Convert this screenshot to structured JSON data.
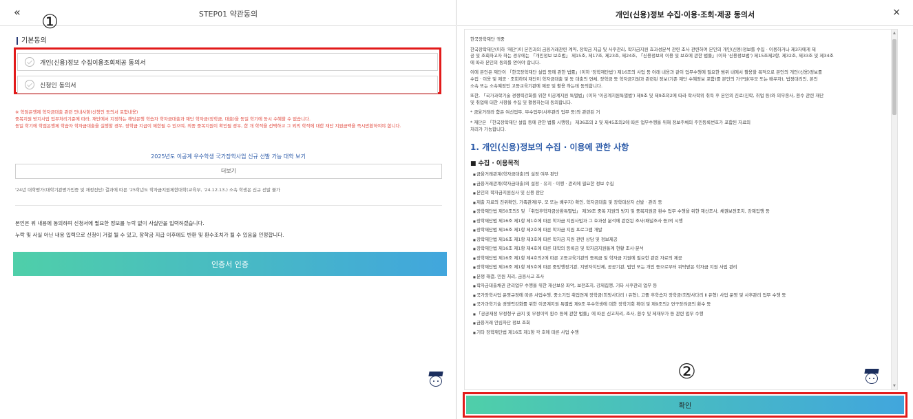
{
  "left": {
    "back_glyph": "«",
    "title": "STEP01 약관동의",
    "annotation": "①",
    "section_title": "기본동의",
    "consents": [
      {
        "label": "개인(신용)정보 수집이용조회제공 동의서"
      },
      {
        "label": "신청인 동의서"
      }
    ],
    "notice": [
      "※ 학점은행제 학자금대출 관련 안내사항(신청인 동의서 포함내용)",
      "중복지원 방지사업 업무처리기준에 따라, 재단에서 지정하는 해당은행 학습자 학자금대출과 재단 학자금(장학금, 대출)을 동일 학기에 동시 수혜할 수 없습니다.",
      "동일 학기에 학점은행제 학습자 학자금대출을 실행할 경우, 장학금 지급이 제한될 수 있으며, 최종 중복지원이 확인될 경우, 한 개 학적을 선택하고 그 외의 학적에 대한 재단 지원금액을 즉시반환하여야 합니다."
    ],
    "uni_link": "2025년도 이공계 우수학생 국가장학사업 신규 선발 가능 대학 보기",
    "more_button": "더보기",
    "small_note": "'24년 대학평가(대학기관평가인증 및 재정진단) 결과에 따른 '25학년도 학자금지원제한대학(교육부, '24.12.13.) 소속 학생은 신규 선발 불가",
    "confirm_line1": "본인은 위 내용에 동의하며 신청서에 필요한 정보를 누락 없이 사실만을 입력하겠습니다.",
    "confirm_line2": "누락 및 사실 아닌 내용 입력으로 신청이 거절 될 수 있고, 장학금 지급 이후에도 반환 및 환수조치가 될 수 있음을 인정합니다.",
    "cert_button": "인증서 인증"
  },
  "right": {
    "title": "개인(신용)정보 수집·이용·조회·제공 동의서",
    "close_glyph": "×",
    "paragraphs": [
      [
        "한국장학재단 귀중"
      ],
      [
        "한국장학재단(이하 '재단')이 본인과의 금융거래관련 계약, 장학금 지급 및 사후관리, 학자금지원 효과성분석 관련 조사 관련하여 본인의 개인(신용)정보를 수집 · 이용하거나 제3자에게 제",
        "공 및 조회하고자 하는 경우에는 「개인정보 보호법」 제15조, 제17조, 제23조, 제24조, 「신용정보의 이용 및 보호에 관한 법률」(이하 '신용정보법') 제15조제2항, 제32조, 제33조 및 제34조",
        "에 따라 본인의 동의를 얻어야 합니다."
      ],
      [
        "이에 본인은 재단이 「한국장학재단 설립 등에 관한 법률」(이하 '장학재단법') 제16조의 사업 등 아래 내용과 같이 업무수행에 필요한 범위 내에서 활용할 목적으로 본인의 개인(신용)정보를",
        "수집 · 이용 및 제공 · 조회하며 재단이 학자금대출 및 동 대출의 연체, 장학금 등 학자금지원과 관련된 정보(기존 재단 수혜정보 포함)를 본인의 가구원(부모 또는 배우자), 법정대리인, 본인",
        "소속 또는 소속예정인 고등교육기관에 제공 및 활용 하는데 동의합니다."
      ],
      [
        "또한, 「국가과학기술 경쟁력강화를 위한 이공계지원 특별법」(이하 '이공계지원특별법') 제9조 및 제9조의2에 따라 학사학위 취득 후 본인의 진로(진학, 취업 등)와 의무종사, 환수 관련 재단",
        "및 취업에 대한 사항을 수집 및 활용하는데 동의합니다."
      ],
      [
        "* 금융거래라 함은 여신업무, 부수업무(사후관리 업무 등)와 관련된 거"
      ],
      [
        "* 재단은 「한국장학재단 설립 등에 관한 법률 시행령」 제36조의 2 및                                                                    제45조의2에 따른 업무수행을 위해 정보주체의 주민등록번호가 포함된 자료의",
        "   처리가 가능합니다."
      ]
    ],
    "section_heading": "1. 개인(신용)정보의 수집 · 이용에 관한 사항",
    "subsection": "■ 수집 · 이용목적",
    "bullets": [
      "금융거래관계(학자금대출)의 설정 여부 판단",
      "금융거래관계(학자금대출)의 설정 · 유지 · 이행 · 관리에 필요한 정보 수집",
      "본인의 학자금지원심사 및 신용 판단",
      "제출 자료의 진위확인, 가족관계(부, 모 또는 배우자) 확인, 학자금대출 및 장학대상자 선발 · 관리 등",
      "장학재단법 제50조의5 및 「취업후학자금상환특별법」 제39조 중복 지원의 방지 및 중복지원금 환수 업무 수행을 위한 재산조사, 채권보전조치, 강제집행 등",
      "장학재단법 제16조 제1항 제1호에 따른 학자금 지원사업과 그 효과성 분석에 관련된 조사(패널조사 등)의 시행",
      "장학재단법 제16조 제1항 제2호에 따른 학자금 지원 프로그램 개발",
      "장학재단법 제16조 제1항 제3호에 따른 학자금 지원 관련 상담 및 정보제공",
      "장학재단법 제16조 제1항 제4호에 따른 대학의 등록금 및 학자금지원통계 현황 조사·분석",
      "장학재단법 제16조 제1항 제4호의2에 따른 고등교육기관의 등록금 및 학자금 지원에 필요한 관련 자료의 제공",
      "장학재단법 제16조 제1항 제5호에 따른 중앙행정기관, 지방자치단체, 공공기관, 법인 또는 개인 등으로부터 위탁받은 학자금 지원 사업 관리",
      "분쟁 해결, 민원 처리, 금융사고 조사",
      "학자금대출채권 관리업무 수행을 위한 재산보유 파악, 보전조치, 강제집행, 기타 사후관리 업무 등",
      "국가장학사업 운영규정에 따른 사업수행, 중소기업 취업연계 장학금(희망사다리 Ⅰ 유형), 고졸 후학습자 장학금(희망사다리 Ⅱ 유형) 사업 운영 및 사후관리 업무 수행 등",
      "국가과학기술 경쟁력강화를 위한 이공계지원 특별법 제9조 우수학생에 대한 장학기회 확대 및 제9조의2 연구장려금의 환수 등",
      "「공공재정 부정청구 금지 및 부정이익 환수 등에 관한 법률」에 따른 신고처리, 조사, 환수 및 제재부가 등 관련 업무 수행",
      "금융거래 안심차단 정보 조회",
      "기타 장학재단법 제16조 제1항 각 호에 따른 사업 수행"
    ],
    "annotation": "②",
    "confirm_button": "확인"
  }
}
